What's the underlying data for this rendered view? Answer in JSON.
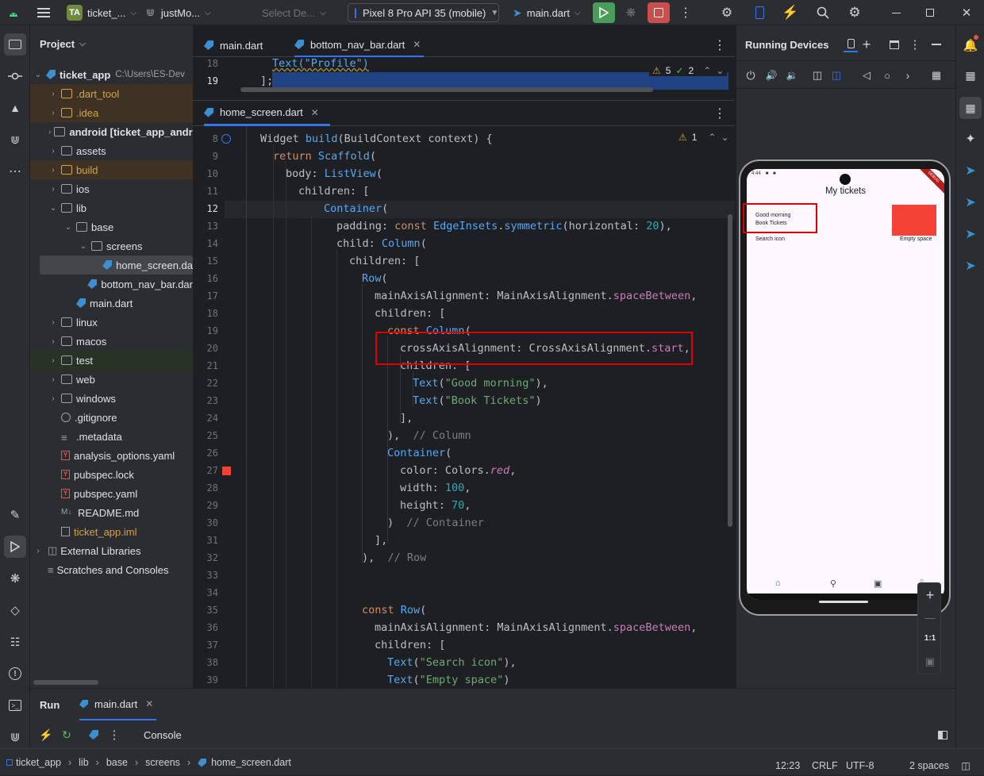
{
  "titlebar": {
    "project_badge": "TA",
    "project_name": "ticket_...",
    "branch": "justMo...",
    "select_device_placeholder": "Select De...",
    "device": "Pixel 8 Pro API 35 (mobile)",
    "run_config": "main.dart"
  },
  "project_panel": {
    "title": "Project",
    "root_name": "ticket_app",
    "root_path": "C:\\Users\\ES-Dev",
    "items": [
      {
        "label": ".dart_tool",
        "depth": 1,
        "kind": "folder",
        "expand": "closed",
        "style": "excluded"
      },
      {
        "label": ".idea",
        "depth": 1,
        "kind": "folder",
        "expand": "closed",
        "style": "excluded"
      },
      {
        "label": "android [ticket_app_andro",
        "depth": 1,
        "kind": "folder",
        "expand": "closed",
        "style": "bold"
      },
      {
        "label": "assets",
        "depth": 1,
        "kind": "folder",
        "expand": "closed",
        "style": "normal"
      },
      {
        "label": "build",
        "depth": 1,
        "kind": "folder",
        "expand": "closed",
        "style": "excluded"
      },
      {
        "label": "ios",
        "depth": 1,
        "kind": "folder",
        "expand": "closed",
        "style": "normal"
      },
      {
        "label": "lib",
        "depth": 1,
        "kind": "folder",
        "expand": "open",
        "style": "normal"
      },
      {
        "label": "base",
        "depth": 2,
        "kind": "folder",
        "expand": "open",
        "style": "normal"
      },
      {
        "label": "screens",
        "depth": 3,
        "kind": "folder",
        "expand": "open",
        "style": "normal"
      },
      {
        "label": "home_screen.da",
        "depth": 4,
        "kind": "dart",
        "expand": "none",
        "style": "selected"
      },
      {
        "label": "bottom_nav_bar.dar",
        "depth": 3,
        "kind": "dart",
        "expand": "none",
        "style": "normal"
      },
      {
        "label": "main.dart",
        "depth": 2,
        "kind": "dart",
        "expand": "none",
        "style": "normal"
      },
      {
        "label": "linux",
        "depth": 1,
        "kind": "folder",
        "expand": "closed",
        "style": "normal"
      },
      {
        "label": "macos",
        "depth": 1,
        "kind": "folder",
        "expand": "closed",
        "style": "normal"
      },
      {
        "label": "test",
        "depth": 1,
        "kind": "folder",
        "expand": "closed",
        "style": "test"
      },
      {
        "label": "web",
        "depth": 1,
        "kind": "folder",
        "expand": "closed",
        "style": "normal"
      },
      {
        "label": "windows",
        "depth": 1,
        "kind": "folder",
        "expand": "closed",
        "style": "normal"
      },
      {
        "label": ".gitignore",
        "depth": 1,
        "kind": "generic",
        "expand": "none",
        "style": "normal"
      },
      {
        "label": ".metadata",
        "depth": 1,
        "kind": "lines",
        "expand": "none",
        "style": "normal"
      },
      {
        "label": "analysis_options.yaml",
        "depth": 1,
        "kind": "yaml",
        "expand": "none",
        "style": "normal"
      },
      {
        "label": "pubspec.lock",
        "depth": 1,
        "kind": "yaml",
        "expand": "none",
        "style": "normal"
      },
      {
        "label": "pubspec.yaml",
        "depth": 1,
        "kind": "yaml",
        "expand": "none",
        "style": "normal"
      },
      {
        "label": "README.md",
        "depth": 1,
        "kind": "md",
        "expand": "none",
        "style": "normal"
      },
      {
        "label": "ticket_app.iml",
        "depth": 1,
        "kind": "iml",
        "expand": "none",
        "style": "excluded-text"
      }
    ],
    "external_libraries": "External Libraries",
    "scratches": "Scratches and Consoles"
  },
  "top_editor": {
    "tabs": [
      {
        "label": "main.dart",
        "active": false,
        "closable": false
      },
      {
        "label": "bottom_nav_bar.dart",
        "active": true,
        "closable": true
      }
    ],
    "lines": [
      {
        "num": "18",
        "text": "Text(\"Profile\")"
      },
      {
        "num": "19",
        "text": "];"
      }
    ],
    "warnings": "5",
    "checks": "2"
  },
  "bottom_editor": {
    "tab": "home_screen.dart",
    "warnings": "1",
    "current_line": "12"
  },
  "code_lines": [
    {
      "num": "8",
      "indent": 0,
      "tokens": [
        [
          "",
          "Widget "
        ],
        [
          "fn",
          "build"
        ],
        [
          "",
          "(BuildContext context) {"
        ]
      ]
    },
    {
      "num": "9",
      "indent": 1,
      "tokens": [
        [
          "kw",
          "return "
        ],
        [
          "ty",
          "Scaffold"
        ],
        [
          "",
          "("
        ]
      ]
    },
    {
      "num": "10",
      "indent": 2,
      "tokens": [
        [
          "",
          "body: "
        ],
        [
          "ty",
          "ListView"
        ],
        [
          "",
          "("
        ]
      ]
    },
    {
      "num": "11",
      "indent": 3,
      "tokens": [
        [
          "",
          "children: ["
        ]
      ]
    },
    {
      "num": "12",
      "indent": 5,
      "tokens": [
        [
          "ty",
          "Container"
        ],
        [
          "",
          "("
        ]
      ]
    },
    {
      "num": "13",
      "indent": 6,
      "tokens": [
        [
          "",
          "padding: "
        ],
        [
          "kw",
          "const "
        ],
        [
          "ty",
          "EdgeInsets"
        ],
        [
          "",
          "."
        ],
        [
          "fn",
          "symmetric"
        ],
        [
          "",
          "(horizontal: "
        ],
        [
          "num",
          "20"
        ],
        [
          "",
          "),"
        ]
      ]
    },
    {
      "num": "14",
      "indent": 6,
      "tokens": [
        [
          "",
          "child: "
        ],
        [
          "ty",
          "Column"
        ],
        [
          "",
          "("
        ]
      ]
    },
    {
      "num": "15",
      "indent": 7,
      "tokens": [
        [
          "",
          "children: ["
        ]
      ]
    },
    {
      "num": "16",
      "indent": 8,
      "tokens": [
        [
          "ty",
          "Row"
        ],
        [
          "",
          "("
        ]
      ]
    },
    {
      "num": "17",
      "indent": 9,
      "tokens": [
        [
          "",
          "mainAxisAlignment: MainAxisAlignment."
        ],
        [
          "pr",
          "spaceBetween"
        ],
        [
          "",
          ","
        ]
      ]
    },
    {
      "num": "18",
      "indent": 9,
      "tokens": [
        [
          "",
          "children: ["
        ]
      ]
    },
    {
      "num": "19",
      "indent": 10,
      "tokens": [
        [
          "kw",
          "const "
        ],
        [
          "ty",
          "Column"
        ],
        [
          "",
          "("
        ]
      ]
    },
    {
      "num": "20",
      "indent": 11,
      "tokens": [
        [
          "",
          "crossAxisAlignment: CrossAxisAlignment."
        ],
        [
          "pr",
          "start"
        ],
        [
          "",
          ","
        ]
      ]
    },
    {
      "num": "21",
      "indent": 11,
      "tokens": [
        [
          "",
          "children: ["
        ]
      ]
    },
    {
      "num": "22",
      "indent": 12,
      "tokens": [
        [
          "ty",
          "Text"
        ],
        [
          "",
          "("
        ],
        [
          "str",
          "\"Good morning\""
        ],
        [
          "",
          "),"
        ]
      ]
    },
    {
      "num": "23",
      "indent": 12,
      "tokens": [
        [
          "ty",
          "Text"
        ],
        [
          "",
          "("
        ],
        [
          "str",
          "\"Book Tickets\""
        ],
        [
          "",
          ")"
        ]
      ]
    },
    {
      "num": "24",
      "indent": 11,
      "tokens": [
        [
          "",
          "],"
        ]
      ]
    },
    {
      "num": "25",
      "indent": 10,
      "tokens": [
        [
          "",
          "),  "
        ],
        [
          "cm",
          "// Column"
        ]
      ]
    },
    {
      "num": "26",
      "indent": 10,
      "tokens": [
        [
          "ty",
          "Container"
        ],
        [
          "",
          "("
        ]
      ]
    },
    {
      "num": "27",
      "indent": 11,
      "tokens": [
        [
          "",
          "color: Colors."
        ],
        [
          "it",
          "red"
        ],
        [
          "",
          ","
        ]
      ]
    },
    {
      "num": "28",
      "indent": 11,
      "tokens": [
        [
          "",
          "width: "
        ],
        [
          "num",
          "100"
        ],
        [
          "",
          ","
        ]
      ]
    },
    {
      "num": "29",
      "indent": 11,
      "tokens": [
        [
          "",
          "height: "
        ],
        [
          "num",
          "70"
        ],
        [
          "",
          ","
        ]
      ]
    },
    {
      "num": "30",
      "indent": 10,
      "tokens": [
        [
          "",
          ")  "
        ],
        [
          "cm",
          "// Container"
        ]
      ]
    },
    {
      "num": "31",
      "indent": 9,
      "tokens": [
        [
          "",
          "],"
        ]
      ]
    },
    {
      "num": "32",
      "indent": 8,
      "tokens": [
        [
          "",
          "),  "
        ],
        [
          "cm",
          "// Row"
        ]
      ]
    },
    {
      "num": "33",
      "indent": 0,
      "tokens": []
    },
    {
      "num": "34",
      "indent": 0,
      "tokens": []
    },
    {
      "num": "35",
      "indent": 8,
      "tokens": [
        [
          "kw",
          "const "
        ],
        [
          "ty",
          "Row"
        ],
        [
          "",
          "("
        ]
      ]
    },
    {
      "num": "36",
      "indent": 9,
      "tokens": [
        [
          "",
          "mainAxisAlignment: MainAxisAlignment."
        ],
        [
          "pr",
          "spaceBetween"
        ],
        [
          "",
          ","
        ]
      ]
    },
    {
      "num": "37",
      "indent": 9,
      "tokens": [
        [
          "",
          "children: ["
        ]
      ]
    },
    {
      "num": "38",
      "indent": 10,
      "tokens": [
        [
          "ty",
          "Text"
        ],
        [
          "",
          "("
        ],
        [
          "str",
          "\"Search icon\""
        ],
        [
          "",
          "),"
        ]
      ]
    },
    {
      "num": "39",
      "indent": 10,
      "tokens": [
        [
          "ty",
          "Text"
        ],
        [
          "",
          "("
        ],
        [
          "str",
          "\"Empty space\""
        ],
        [
          "",
          ")"
        ]
      ]
    }
  ],
  "running_devices": {
    "title": "Running Devices",
    "zoom_ratio": "1:1"
  },
  "emulator": {
    "status_time": "4:44",
    "appbar_title": "My tickets",
    "debug_banner": "DEBUG",
    "greeting": "Good morning",
    "subtitle": "Book Tickets",
    "search_text": "Search icon",
    "empty_text": "Empty space",
    "box_color": "#f44336"
  },
  "run_panel": {
    "run_label": "Run",
    "config_tab": "main.dart",
    "console_tab": "Console"
  },
  "statusbar": {
    "breadcrumbs": [
      "ticket_app",
      "lib",
      "base",
      "screens",
      "home_screen.dart"
    ],
    "position": "12:23",
    "line_sep": "CRLF",
    "encoding": "UTF-8",
    "indent": "2 spaces"
  },
  "colors": {
    "accent": "#3574f0",
    "highlight_box": "#e00000",
    "run_green": "#4a9c5a",
    "stop_red": "#c94f4f"
  }
}
